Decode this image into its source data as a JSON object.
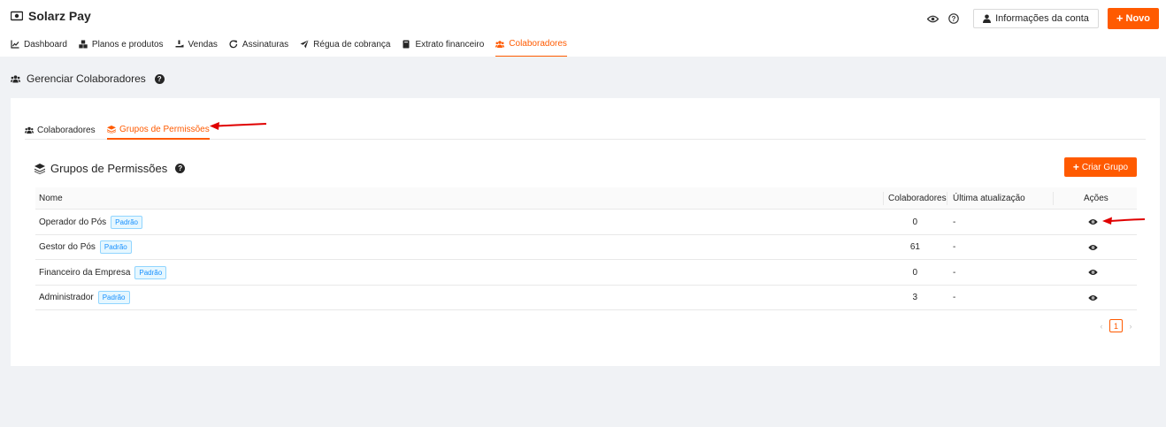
{
  "app": {
    "title": "Solarz Pay"
  },
  "header": {
    "account_label": "Informações da conta",
    "new_label": "Novo"
  },
  "nav": {
    "items": [
      {
        "label": "Dashboard",
        "icon": "chart-line-icon"
      },
      {
        "label": "Planos e produtos",
        "icon": "boxes-icon"
      },
      {
        "label": "Vendas",
        "icon": "hand-holding-dollar-icon"
      },
      {
        "label": "Assinaturas",
        "icon": "redo-icon"
      },
      {
        "label": "Régua de cobrança",
        "icon": "paper-plane-icon"
      },
      {
        "label": "Extrato financeiro",
        "icon": "book-icon"
      },
      {
        "label": "Colaboradores",
        "icon": "users-icon",
        "active": true
      }
    ]
  },
  "page": {
    "title": "Gerenciar Colaboradores"
  },
  "tabs": [
    {
      "label": "Colaboradores"
    },
    {
      "label": "Grupos de Permissões",
      "active": true
    }
  ],
  "section": {
    "title": "Grupos de Permissões",
    "create_label": "Criar Grupo"
  },
  "table": {
    "columns": [
      "Nome",
      "Colaboradores",
      "Última atualização",
      "Ações"
    ],
    "rows": [
      {
        "name": "Operador do Pós",
        "tag": "Padrão",
        "count": "0",
        "updated": "-"
      },
      {
        "name": "Gestor do Pós",
        "tag": "Padrão",
        "count": "61",
        "updated": "-"
      },
      {
        "name": "Financeiro da Empresa",
        "tag": "Padrão",
        "count": "0",
        "updated": "-"
      },
      {
        "name": "Administrador",
        "tag": "Padrão",
        "count": "3",
        "updated": "-"
      }
    ]
  },
  "pagination": {
    "current": "1"
  },
  "colors": {
    "accent": "#ff5a00",
    "tag_blue": "#1890ff",
    "annotation_red": "#e00000"
  }
}
